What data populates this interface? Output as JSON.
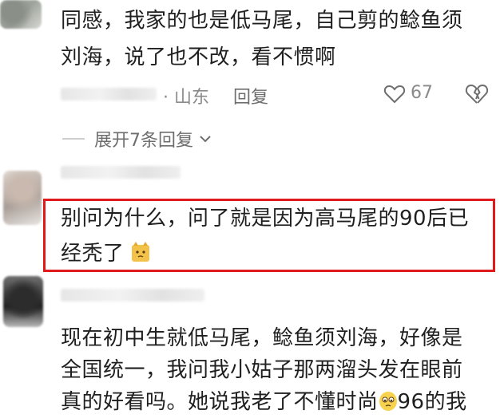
{
  "comment1": {
    "text_line1": "同感，我家的也是低马尾，自己剪的鲶鱼须",
    "text_line2": "刘海，说了也不改，看不惯啊",
    "location": "· 山东",
    "reply_label": "回复",
    "like_count": "67"
  },
  "replies": {
    "expand_label": "展开7条回复"
  },
  "comment2": {
    "text_line1": "别问为什么，问了就是因为高马尾的90后已",
    "text_line2": "经秃了"
  },
  "comment3": {
    "text_line1": "现在初中生就低马尾，鲶鱼须刘海，好像是",
    "text_line2": "全国统一，我问我小姑子那两溜头发在眼前",
    "text_line3_a": "真的好看吗。她说我老了不懂时尚",
    "text_line3_b": "96的我"
  },
  "colors": {
    "highlight": "#e0191d",
    "meta_gray": "#8a8a8a",
    "text": "#1f1f1f"
  },
  "icons": [
    "heart-outline-icon",
    "broken-heart-icon",
    "chevron-down-icon",
    "cat-emoji-icon",
    "teary-face-emoji-icon"
  ]
}
